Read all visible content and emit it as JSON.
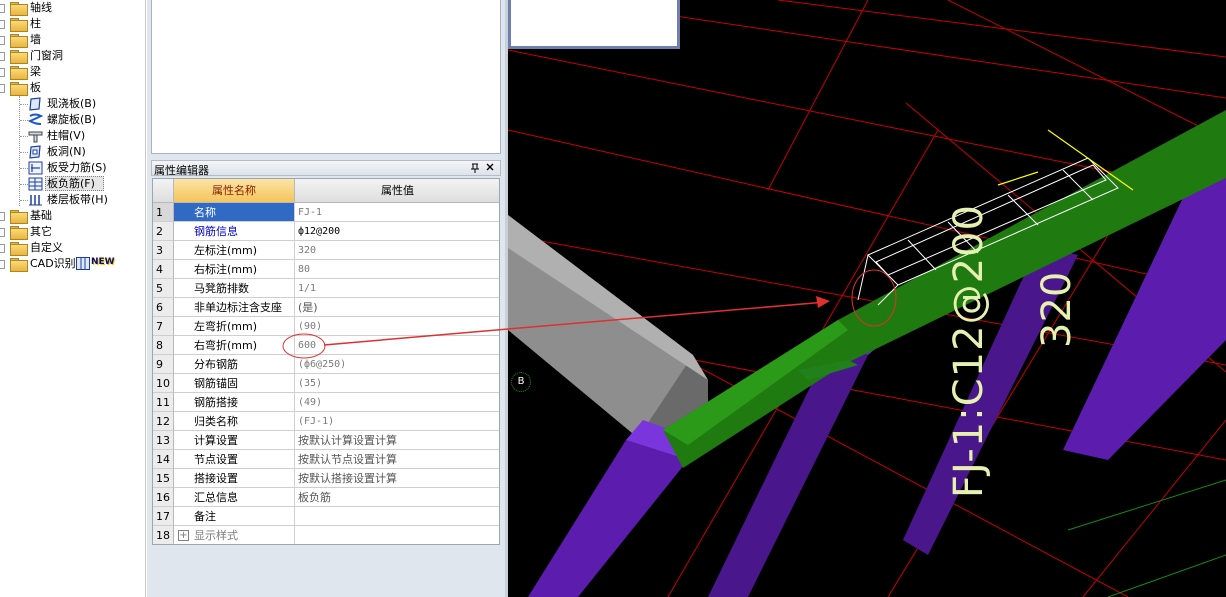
{
  "tree": {
    "folders": [
      {
        "label": "轴线"
      },
      {
        "label": "柱"
      },
      {
        "label": "墙"
      },
      {
        "label": "门窗洞"
      },
      {
        "label": "梁"
      },
      {
        "label": "板"
      }
    ],
    "slab_children": [
      {
        "label": "现浇板(B)",
        "icon": "cast-slab-icon"
      },
      {
        "label": "螺旋板(B)",
        "icon": "spiral-slab-icon"
      },
      {
        "label": "柱帽(V)",
        "icon": "column-cap-icon"
      },
      {
        "label": "板洞(N)",
        "icon": "slab-hole-icon"
      },
      {
        "label": "板受力筋(S)",
        "icon": "slab-rebar-icon"
      },
      {
        "label": "板负筋(F)",
        "icon": "slab-negative-rebar-icon"
      },
      {
        "label": "楼层板带(H)",
        "icon": "floor-slab-strip-icon"
      }
    ],
    "bottom_folders": [
      {
        "label": "基础"
      },
      {
        "label": "其它"
      },
      {
        "label": "自定义"
      },
      {
        "label": "CAD识别"
      }
    ],
    "new_badge": "NEW"
  },
  "property_editor": {
    "title": "属性编辑器",
    "header_name": "属性名称",
    "header_value": "属性值",
    "rows": [
      {
        "num": "1",
        "name": "名称",
        "value": "FJ-1"
      },
      {
        "num": "2",
        "name": "钢筋信息",
        "value": "ф12@200"
      },
      {
        "num": "3",
        "name": "左标注(mm)",
        "value": "320"
      },
      {
        "num": "4",
        "name": "右标注(mm)",
        "value": "80"
      },
      {
        "num": "5",
        "name": "马凳筋排数",
        "value": "1/1"
      },
      {
        "num": "6",
        "name": "非单边标注含支座",
        "value": "(是)"
      },
      {
        "num": "7",
        "name": "左弯折(mm)",
        "value": "(90)"
      },
      {
        "num": "8",
        "name": "右弯折(mm)",
        "value": "600"
      },
      {
        "num": "9",
        "name": "分布钢筋",
        "value": "(ф6@250)"
      },
      {
        "num": "10",
        "name": "钢筋锚固",
        "value": "(35)"
      },
      {
        "num": "11",
        "name": "钢筋搭接",
        "value": "(49)"
      },
      {
        "num": "12",
        "name": "归类名称",
        "value": "(FJ-1)"
      },
      {
        "num": "13",
        "name": "计算设置",
        "value": "按默认计算设置计算"
      },
      {
        "num": "14",
        "name": "节点设置",
        "value": "按默认节点设置计算"
      },
      {
        "num": "15",
        "name": "搭接设置",
        "value": "按默认搭接设置计算"
      },
      {
        "num": "16",
        "name": "汇总信息",
        "value": "板负筋"
      },
      {
        "num": "17",
        "name": "备注",
        "value": ""
      },
      {
        "num": "18",
        "name": "显示样式",
        "value": ""
      }
    ]
  },
  "viewport": {
    "rebar_label": "FJ-1:C12@200",
    "dimension_label": "320",
    "axis_label": "B",
    "colors": {
      "background": "#000000",
      "beam": "#1f7a10",
      "column": "#5a1aa8",
      "grid_red": "#c80000",
      "annotation_arrow": "#e03030",
      "label_text": "#e6f0b0"
    }
  }
}
